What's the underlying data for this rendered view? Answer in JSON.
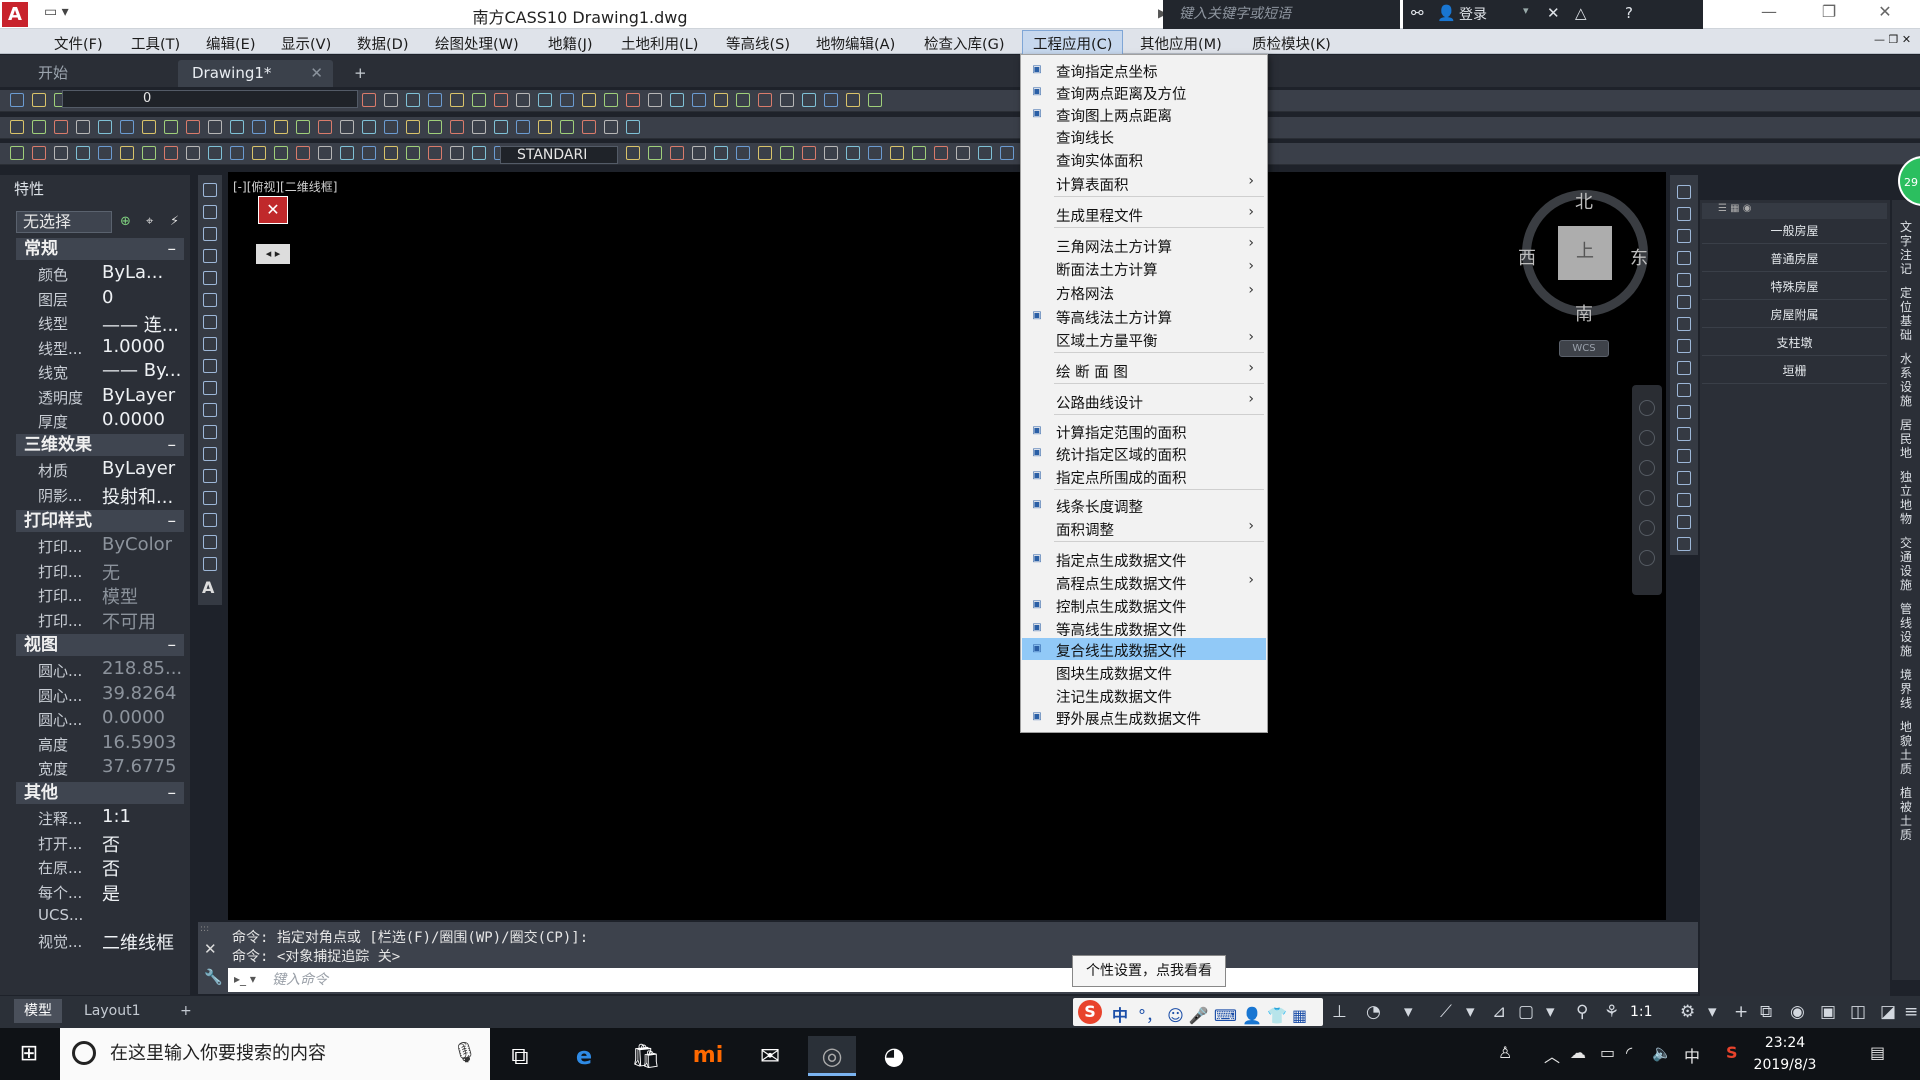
{
  "titlebar": {
    "app_title": "南方CASS10    Drawing1.dwg",
    "search_placeholder": "键入关键字或短语",
    "login_label": "登录"
  },
  "menubar": {
    "items": [
      "文件(F)",
      "工具(T)",
      "编辑(E)",
      "显示(V)",
      "数据(D)",
      "绘图处理(W)",
      "地籍(J)",
      "土地利用(L)",
      "等高线(S)",
      "地物编辑(A)",
      "检查入库(G)",
      "工程应用(C)",
      "其他应用(M)",
      "质检模块(K)"
    ],
    "active": "工程应用(C)"
  },
  "tabs": {
    "start": "开始",
    "drawing": "Drawing1*"
  },
  "toolbar": {
    "layer_value": "0",
    "text_style": "STANDARI"
  },
  "properties": {
    "title": "特性",
    "selection": "无选择",
    "sections": {
      "general": "常规",
      "effects3d": "三维效果",
      "plot_style": "打印样式",
      "view": "视图",
      "misc": "其他"
    },
    "general": [
      {
        "key": "颜色",
        "value": "ByLa..."
      },
      {
        "key": "图层",
        "value": "0"
      },
      {
        "key": "线型",
        "value": "—— 连..."
      },
      {
        "key": "线型...",
        "value": "1.0000"
      },
      {
        "key": "线宽",
        "value": "—— By..."
      },
      {
        "key": "透明度",
        "value": "ByLayer"
      },
      {
        "key": "厚度",
        "value": "0.0000"
      }
    ],
    "effects3d": [
      {
        "key": "材质",
        "value": "ByLayer"
      },
      {
        "key": "阴影...",
        "value": "投射和..."
      }
    ],
    "plot_style": [
      {
        "key": "打印...",
        "value": "ByColor"
      },
      {
        "key": "打印...",
        "value": "无"
      },
      {
        "key": "打印...",
        "value": "模型"
      },
      {
        "key": "打印...",
        "value": "不可用"
      }
    ],
    "view": [
      {
        "key": "圆心...",
        "value": "218.85..."
      },
      {
        "key": "圆心...",
        "value": "39.8264"
      },
      {
        "key": "圆心...",
        "value": "0.0000"
      },
      {
        "key": "高度",
        "value": "16.5903"
      },
      {
        "key": "宽度",
        "value": "37.6775"
      }
    ],
    "misc": [
      {
        "key": "注释...",
        "value": "1:1"
      },
      {
        "key": "打开...",
        "value": "否"
      },
      {
        "key": "在原...",
        "value": "否"
      },
      {
        "key": "每个...",
        "value": "是"
      },
      {
        "key": "UCS...",
        "value": ""
      },
      {
        "key": "视觉...",
        "value": "二维线框"
      }
    ]
  },
  "viewport": {
    "label": "[-][俯视][二维线框]",
    "compass": {
      "north": "北",
      "south": "南",
      "east": "东",
      "west": "西",
      "top": "上"
    },
    "wcs": "WCS"
  },
  "dropdown": {
    "items": [
      {
        "label": "查询指定点坐标",
        "sub": false,
        "icon": true
      },
      {
        "label": "查询两点距离及方位",
        "sub": false,
        "icon": true
      },
      {
        "label": "查询图上两点距离",
        "sub": false,
        "icon": true
      },
      {
        "label": "查询线长",
        "sub": false,
        "icon": false
      },
      {
        "label": "查询实体面积",
        "sub": false,
        "icon": false
      },
      {
        "label": "计算表面积",
        "sub": true,
        "icon": false
      },
      {
        "label": "生成里程文件",
        "sub": true,
        "icon": false
      },
      {
        "label": "三角网法土方计算",
        "sub": true,
        "icon": false
      },
      {
        "label": "断面法土方计算",
        "sub": true,
        "icon": false
      },
      {
        "label": "方格网法",
        "sub": true,
        "icon": false
      },
      {
        "label": "等高线法土方计算",
        "sub": false,
        "icon": true
      },
      {
        "label": "区域土方量平衡",
        "sub": true,
        "icon": false
      },
      {
        "label": "绘 断 面 图",
        "sub": true,
        "icon": false
      },
      {
        "label": "公路曲线设计",
        "sub": true,
        "icon": false
      },
      {
        "label": "计算指定范围的面积",
        "sub": false,
        "icon": true
      },
      {
        "label": "统计指定区域的面积",
        "sub": false,
        "icon": true
      },
      {
        "label": "指定点所围成的面积",
        "sub": false,
        "icon": true
      },
      {
        "label": "线条长度调整",
        "sub": false,
        "icon": true
      },
      {
        "label": "面积调整",
        "sub": true,
        "icon": false
      },
      {
        "label": "指定点生成数据文件",
        "sub": false,
        "icon": true
      },
      {
        "label": "高程点生成数据文件",
        "sub": true,
        "icon": false
      },
      {
        "label": "控制点生成数据文件",
        "sub": false,
        "icon": true
      },
      {
        "label": "等高线生成数据文件",
        "sub": false,
        "icon": true
      },
      {
        "label": "复合线生成数据文件",
        "sub": false,
        "icon": true
      },
      {
        "label": "图块生成数据文件",
        "sub": false,
        "icon": false
      },
      {
        "label": "注记生成数据文件",
        "sub": false,
        "icon": false
      },
      {
        "label": "野外展点生成数据文件",
        "sub": false,
        "icon": true
      }
    ],
    "highlighted": "复合线生成数据文件"
  },
  "right_panel": {
    "items": [
      "一般房屋",
      "普通房屋",
      "特殊房屋",
      "房屋附属",
      "支柱墩",
      "垣栅"
    ],
    "vertical_tabs": [
      "文字注记",
      "定位基础",
      "水系设施",
      "居民地",
      "独立地物",
      "交通设施",
      "管线设施",
      "境界线",
      "地貌土质",
      "植被土质"
    ],
    "badge": "29"
  },
  "command": {
    "line1": "命令: 指定对角点或 [栏选(F)/圈围(WP)/圈交(CP)]:",
    "line2": "命令: <对象捕捉追踪 关>",
    "input_placeholder": "键入命令"
  },
  "tooltip": "个性设置，点我看看",
  "status": {
    "model_tab": "模型",
    "layout_tab": "Layout1",
    "scale": "1:1",
    "ime": "中"
  },
  "taskbar": {
    "search_placeholder": "在这里输入你要搜索的内容",
    "time": "23:24",
    "date": "2019/8/3",
    "lang": "中"
  }
}
